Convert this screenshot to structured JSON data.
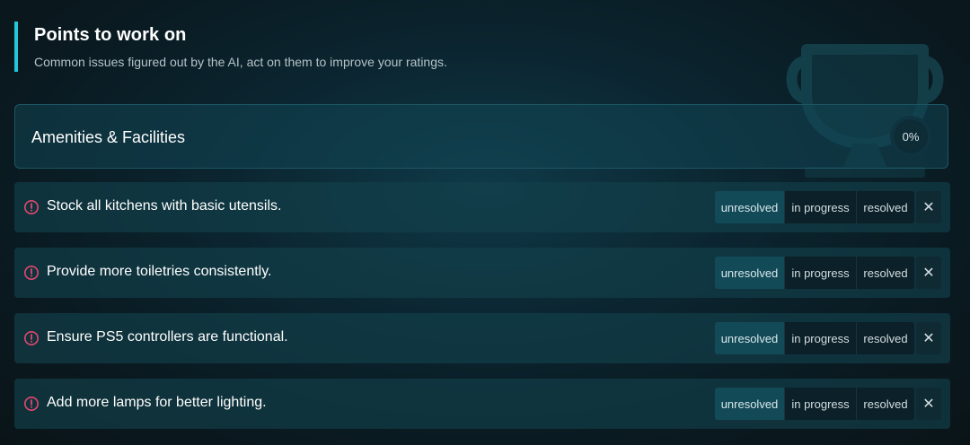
{
  "header": {
    "title": "Points to work on",
    "subtitle": "Common issues figured out by the AI, act on them to improve your ratings."
  },
  "category": {
    "title": "Amenities & Facilities",
    "progress_label": "0%",
    "progress_value": 0
  },
  "status_labels": {
    "unresolved": "unresolved",
    "in_progress": "in progress",
    "resolved": "resolved",
    "close": "✕"
  },
  "issues": [
    {
      "text": "Stock all kitchens with basic utensils.",
      "status": "unresolved"
    },
    {
      "text": "Provide more toiletries consistently.",
      "status": "unresolved"
    },
    {
      "text": "Ensure PS5 controllers are functional.",
      "status": "unresolved"
    },
    {
      "text": "Add more lamps for better lighting.",
      "status": "unresolved"
    }
  ],
  "colors": {
    "accent": "#22c7dc",
    "alert": "#e2486f",
    "active_status": "#134a57"
  },
  "icons": {
    "decoration": "trophy-icon",
    "issue": "alert-circle-icon",
    "close": "close-icon"
  }
}
